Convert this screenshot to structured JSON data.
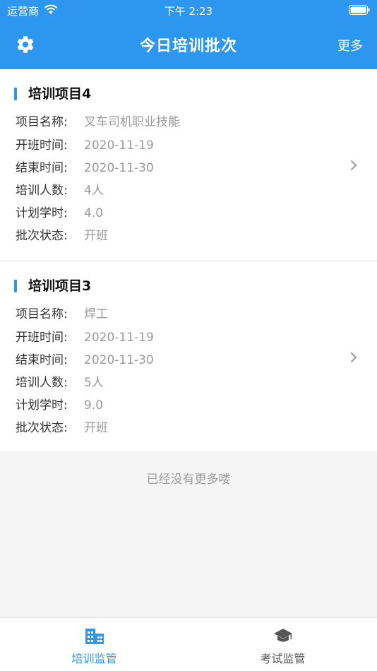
{
  "status_bar": {
    "carrier": "运营商",
    "time": "下午 2:23"
  },
  "header": {
    "title": "今日培训批次",
    "more_label": "更多"
  },
  "labels": {
    "project_name": "项目名称:",
    "start_time": "开班时间:",
    "end_time": "结束时间:",
    "trainee_count": "培训人数:",
    "planned_hours": "计划学时:",
    "batch_status": "批次状态:"
  },
  "batches": [
    {
      "title": "培训项目4",
      "project_name": "叉车司机职业技能",
      "start_time": "2020-11-19",
      "end_time": "2020-11-30",
      "trainee_count": "4人",
      "planned_hours": "4.0",
      "batch_status": "开班"
    },
    {
      "title": "培训项目3",
      "project_name": "焊工",
      "start_time": "2020-11-19",
      "end_time": "2020-11-30",
      "trainee_count": "5人",
      "planned_hours": "9.0",
      "batch_status": "开班"
    }
  ],
  "list_footer": "已经没有更多喽",
  "tabbar": {
    "tabs": [
      {
        "label": "培训监管",
        "icon": "building-icon",
        "active": true
      },
      {
        "label": "考试监管",
        "icon": "graduation-cap-icon",
        "active": false
      }
    ]
  },
  "colors": {
    "accent": "#2d96ef"
  }
}
